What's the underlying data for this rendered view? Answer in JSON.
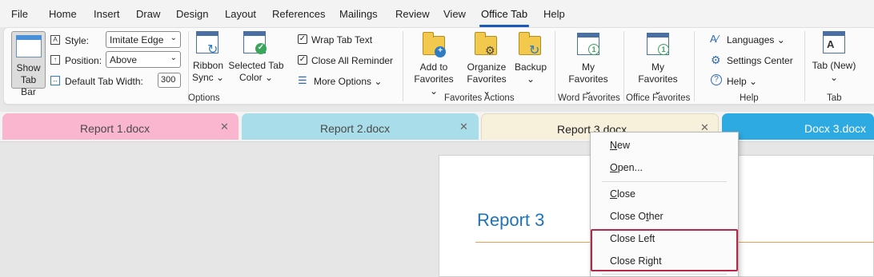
{
  "menubar": {
    "items": [
      "File",
      "Home",
      "Insert",
      "Draw",
      "Design",
      "Layout",
      "References",
      "Mailings",
      "Review",
      "View",
      "Office Tab",
      "Help"
    ],
    "active": "Office Tab"
  },
  "ribbon": {
    "options": {
      "show_tab_bar": "Show Tab Bar",
      "style_label": "Style:",
      "style_value": "Imitate Edge",
      "position_label": "Position:",
      "position_value": "Above",
      "default_width_label": "Default Tab Width:",
      "default_width_value": "300",
      "ribbon_sync_line1": "Ribbon",
      "ribbon_sync_line2": "Sync",
      "selected_tab_line1": "Selected Tab",
      "selected_tab_line2": "Color",
      "wrap_tab_text": "Wrap Tab Text",
      "close_all_reminder": "Close All Reminder",
      "more_options": "More Options",
      "group_label": "Options"
    },
    "favorites_actions": {
      "add_line1": "Add to",
      "add_line2": "Favorites",
      "organize_line1": "Organize",
      "organize_line2": "Favorites",
      "backup_line1": "Backup",
      "group_label": "Favorites Actions"
    },
    "word_favorites": {
      "line1": "My",
      "line2": "Favorites",
      "group_label": "Word Favorites"
    },
    "office_favorites": {
      "line1": "My",
      "line2": "Favorites",
      "group_label": "Office Favorites"
    },
    "help": {
      "languages": "Languages",
      "settings_center": "Settings Center",
      "help": "Help",
      "group_label": "Help"
    },
    "tab": {
      "new_tab": "Tab (New)",
      "group_label": "Tab"
    }
  },
  "tabs": [
    {
      "label": "Report 1.docx",
      "color": "#fbb6cf"
    },
    {
      "label": "Report 2.docx",
      "color": "#a9dde9"
    },
    {
      "label": "Report 3.docx",
      "color": "#f7f1dc"
    },
    {
      "label": "Docx 3.docx",
      "color": "#2eaae3"
    }
  ],
  "document": {
    "title": "Report 3"
  },
  "context_menu": {
    "items": [
      "New",
      "Open...",
      "Close",
      "Close Other",
      "Close Left",
      "Close Right"
    ],
    "highlight_color": "#b52847"
  },
  "colors": {
    "accent": "#185abd",
    "title_blue": "#1e73be",
    "heading_rule": "#e3a24d"
  }
}
